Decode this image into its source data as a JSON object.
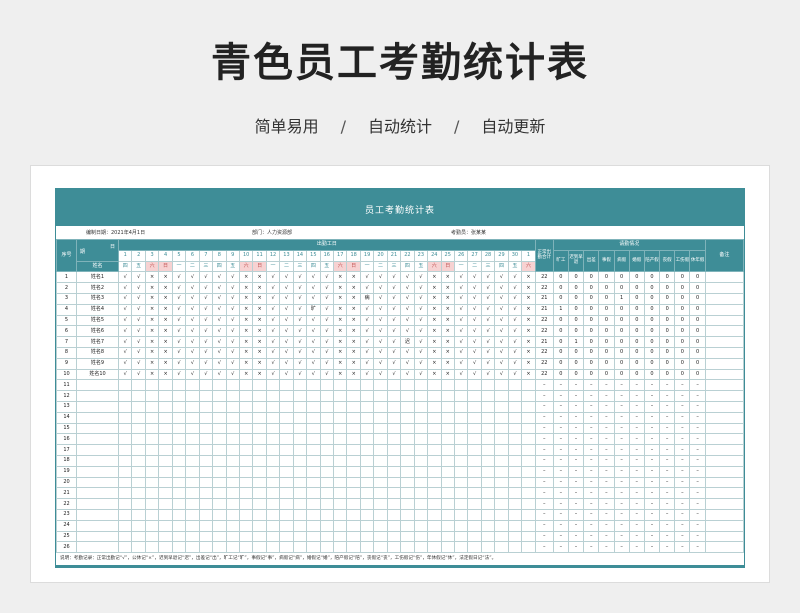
{
  "page": {
    "title": "青色员工考勤统计表",
    "subtitle_parts": [
      "简单易用",
      "自动统计",
      "自动更新"
    ],
    "separator": "/"
  },
  "sheet": {
    "title": "员工考勤统计表",
    "date_label": "编制日期：2021年4月1日",
    "dept_label": "部门：人力资源部",
    "clerk_label": "考勤员：张某某",
    "header": {
      "seq": "序号",
      "name_top": "日",
      "name_mid": "期",
      "name_bottom": "姓名",
      "workdays": "出勤工日",
      "normal": "正常出勤合计",
      "stats": "请勤情况",
      "remark": "备注",
      "stat_cols": [
        "旷工",
        "迟到早退",
        "出差",
        "事假",
        "病假",
        "婚假",
        "陪产假",
        "丧假",
        "工伤假",
        "休年假"
      ],
      "days": [
        "1",
        "2",
        "3",
        "4",
        "5",
        "6",
        "7",
        "8",
        "9",
        "10",
        "11",
        "12",
        "13",
        "14",
        "15",
        "16",
        "17",
        "18",
        "19",
        "20",
        "21",
        "22",
        "23",
        "24",
        "25",
        "26",
        "27",
        "28",
        "29",
        "30",
        "1"
      ],
      "weekdays": [
        "四",
        "五",
        "六",
        "日",
        "一",
        "二",
        "三",
        "四",
        "五",
        "六",
        "日",
        "一",
        "二",
        "三",
        "四",
        "五",
        "六",
        "日",
        "一",
        "二",
        "三",
        "四",
        "五",
        "六",
        "日",
        "一",
        "二",
        "三",
        "四",
        "五",
        "六"
      ],
      "weekend_cols": [
        2,
        3,
        9,
        10,
        16,
        17,
        23,
        24,
        30
      ]
    },
    "rows": [
      {
        "seq": "1",
        "name": "姓名1",
        "marks": [
          "√",
          "√",
          "×",
          "×",
          "√",
          "√",
          "√",
          "√",
          "√",
          "×",
          "×",
          "√",
          "√",
          "√",
          "√",
          "√",
          "×",
          "×",
          "√",
          "√",
          "√",
          "√",
          "√",
          "×",
          "×",
          "√",
          "√",
          "√",
          "√",
          "√",
          "×"
        ],
        "normal": "22",
        "stats": [
          "0",
          "0",
          "0",
          "0",
          "0",
          "0",
          "0",
          "0",
          "0",
          "0"
        ]
      },
      {
        "seq": "2",
        "name": "姓名2",
        "marks": [
          "√",
          "√",
          "×",
          "×",
          "√",
          "√",
          "√",
          "√",
          "√",
          "×",
          "×",
          "√",
          "√",
          "√",
          "√",
          "√",
          "×",
          "×",
          "√",
          "√",
          "√",
          "√",
          "√",
          "×",
          "×",
          "√",
          "√",
          "√",
          "√",
          "√",
          "×"
        ],
        "normal": "22",
        "stats": [
          "0",
          "0",
          "0",
          "0",
          "0",
          "0",
          "0",
          "0",
          "0",
          "0"
        ]
      },
      {
        "seq": "3",
        "name": "姓名3",
        "marks": [
          "√",
          "√",
          "×",
          "×",
          "√",
          "√",
          "√",
          "√",
          "√",
          "×",
          "×",
          "√",
          "√",
          "√",
          "√",
          "√",
          "×",
          "×",
          "病",
          "√",
          "√",
          "√",
          "√",
          "×",
          "×",
          "√",
          "√",
          "√",
          "√",
          "√",
          "×"
        ],
        "normal": "21",
        "stats": [
          "0",
          "0",
          "0",
          "0",
          "1",
          "0",
          "0",
          "0",
          "0",
          "0"
        ]
      },
      {
        "seq": "4",
        "name": "姓名4",
        "marks": [
          "√",
          "√",
          "×",
          "×",
          "√",
          "√",
          "√",
          "√",
          "√",
          "×",
          "×",
          "√",
          "√",
          "√",
          "旷",
          "√",
          "×",
          "×",
          "√",
          "√",
          "√",
          "√",
          "√",
          "×",
          "×",
          "√",
          "√",
          "√",
          "√",
          "√",
          "×"
        ],
        "normal": "21",
        "stats": [
          "1",
          "0",
          "0",
          "0",
          "0",
          "0",
          "0",
          "0",
          "0",
          "0"
        ]
      },
      {
        "seq": "5",
        "name": "姓名5",
        "marks": [
          "√",
          "√",
          "×",
          "×",
          "√",
          "√",
          "√",
          "√",
          "√",
          "×",
          "×",
          "√",
          "√",
          "√",
          "√",
          "√",
          "×",
          "×",
          "√",
          "√",
          "√",
          "√",
          "√",
          "×",
          "×",
          "√",
          "√",
          "√",
          "√",
          "√",
          "×"
        ],
        "normal": "22",
        "stats": [
          "0",
          "0",
          "0",
          "0",
          "0",
          "0",
          "0",
          "0",
          "0",
          "0"
        ]
      },
      {
        "seq": "6",
        "name": "姓名6",
        "marks": [
          "√",
          "√",
          "×",
          "×",
          "√",
          "√",
          "√",
          "√",
          "√",
          "×",
          "×",
          "√",
          "√",
          "√",
          "√",
          "√",
          "×",
          "×",
          "√",
          "√",
          "√",
          "√",
          "√",
          "×",
          "×",
          "√",
          "√",
          "√",
          "√",
          "√",
          "×"
        ],
        "normal": "22",
        "stats": [
          "0",
          "0",
          "0",
          "0",
          "0",
          "0",
          "0",
          "0",
          "0",
          "0"
        ]
      },
      {
        "seq": "7",
        "name": "姓名7",
        "marks": [
          "√",
          "√",
          "×",
          "×",
          "√",
          "√",
          "√",
          "√",
          "√",
          "×",
          "×",
          "√",
          "√",
          "√",
          "√",
          "√",
          "×",
          "×",
          "√",
          "√",
          "√",
          "迟",
          "√",
          "×",
          "×",
          "√",
          "√",
          "√",
          "√",
          "√",
          "×"
        ],
        "normal": "21",
        "stats": [
          "0",
          "1",
          "0",
          "0",
          "0",
          "0",
          "0",
          "0",
          "0",
          "0"
        ]
      },
      {
        "seq": "8",
        "name": "姓名8",
        "marks": [
          "√",
          "√",
          "×",
          "×",
          "√",
          "√",
          "√",
          "√",
          "√",
          "×",
          "×",
          "√",
          "√",
          "√",
          "√",
          "√",
          "×",
          "×",
          "√",
          "√",
          "√",
          "√",
          "√",
          "×",
          "×",
          "√",
          "√",
          "√",
          "√",
          "√",
          "×"
        ],
        "normal": "22",
        "stats": [
          "0",
          "0",
          "0",
          "0",
          "0",
          "0",
          "0",
          "0",
          "0",
          "0"
        ]
      },
      {
        "seq": "9",
        "name": "姓名9",
        "marks": [
          "√",
          "√",
          "×",
          "×",
          "√",
          "√",
          "√",
          "√",
          "√",
          "×",
          "×",
          "√",
          "√",
          "√",
          "√",
          "√",
          "×",
          "×",
          "√",
          "√",
          "√",
          "√",
          "√",
          "×",
          "×",
          "√",
          "√",
          "√",
          "√",
          "√",
          "×"
        ],
        "normal": "22",
        "stats": [
          "0",
          "0",
          "0",
          "0",
          "0",
          "0",
          "0",
          "0",
          "0",
          "0"
        ]
      },
      {
        "seq": "10",
        "name": "姓名10",
        "marks": [
          "√",
          "√",
          "×",
          "×",
          "√",
          "√",
          "√",
          "√",
          "√",
          "×",
          "×",
          "√",
          "√",
          "√",
          "√",
          "√",
          "×",
          "×",
          "√",
          "√",
          "√",
          "√",
          "√",
          "×",
          "×",
          "√",
          "√",
          "√",
          "√",
          "√",
          "×"
        ],
        "normal": "22",
        "stats": [
          "0",
          "0",
          "0",
          "0",
          "0",
          "0",
          "0",
          "0",
          "0",
          "0"
        ]
      }
    ],
    "empty_row_seqs": [
      "11",
      "12",
      "13",
      "14",
      "15",
      "16",
      "17",
      "18",
      "19",
      "20",
      "21",
      "22",
      "23",
      "24",
      "25",
      "26"
    ],
    "empty_mark": "–",
    "note": "说明：考勤记录：正常出勤记“√”，公休记“×”，迟到早退记“迟”，出差记“出”，旷工记“旷”，事假记“事”，病假记“病”，婚假记“婚”，陪产假记“陪”，丧假记“丧”，工伤假记“伤”，年休假记“休”，法定假日记“法”。"
  },
  "colors": {
    "teal": "#3e8d97",
    "weekend_pink": "#f7d2d2"
  }
}
